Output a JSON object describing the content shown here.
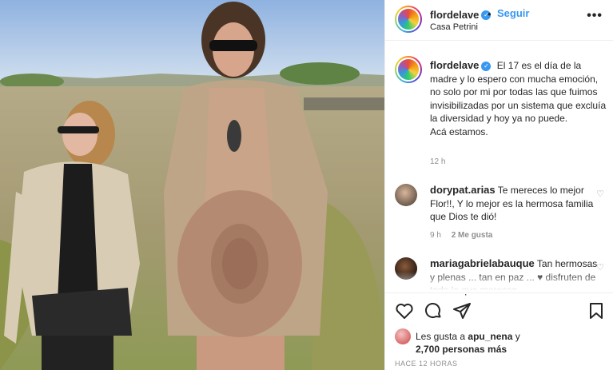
{
  "post": {
    "username": "flordelave",
    "follow_label": "Seguir",
    "separator": "•",
    "location": "Casa Petrini",
    "more_label": "•••",
    "caption": "El 17 es el día de la madre y lo espero con mucha emoción, no solo por mi por todas las que fuimos invisibilizadas por un sistema que excluía la diversidad y hoy ya no puede.",
    "caption_line2": "Acá estamos.",
    "time_ago": "12 h"
  },
  "comments": [
    {
      "username": "dorypat.arias",
      "text": "Te mereces lo mejor Flor!!, Y lo mejor es la hermosa familia que Dios te dió!",
      "time": "9 h",
      "likes": "2 Me gusta"
    },
    {
      "username": "mariagabrielabauque",
      "text": "Tan hermosas y plenas ... tan en paz ... ♥ disfruten de todo lo que merecen"
    }
  ],
  "likes": {
    "prefix": "Les gusta a",
    "user": "apu_nena",
    "connector": "y",
    "others": "2,700 personas más"
  },
  "posted_ago": "HACE 12 HORAS",
  "icons": {
    "verified": "verified-badge-icon",
    "like": "heart-icon",
    "comment": "speech-bubble-icon",
    "share": "paper-plane-icon",
    "save": "bookmark-icon"
  },
  "colors": {
    "accent": "#3897f0",
    "secondary_text": "#8e8e8e"
  }
}
